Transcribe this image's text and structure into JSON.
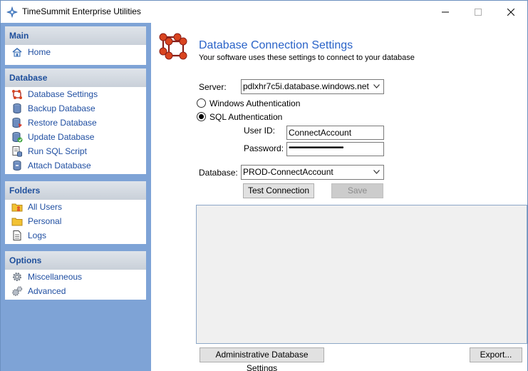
{
  "window": {
    "title": "TimeSummit Enterprise Utilities"
  },
  "sidebar": {
    "main": {
      "header": "Main",
      "items": [
        {
          "label": "Home",
          "icon": "home-icon"
        }
      ]
    },
    "database": {
      "header": "Database",
      "items": [
        {
          "label": "Database Settings",
          "icon": "database-settings-icon"
        },
        {
          "label": "Backup Database",
          "icon": "backup-database-icon"
        },
        {
          "label": "Restore Database",
          "icon": "restore-database-icon"
        },
        {
          "label": "Update Database",
          "icon": "update-database-icon"
        },
        {
          "label": "Run SQL Script",
          "icon": "sql-script-icon"
        },
        {
          "label": "Attach Database",
          "icon": "attach-database-icon"
        }
      ]
    },
    "folders": {
      "header": "Folders",
      "items": [
        {
          "label": "All Users",
          "icon": "all-users-folder-icon"
        },
        {
          "label": "Personal",
          "icon": "personal-folder-icon"
        },
        {
          "label": "Logs",
          "icon": "logs-document-icon"
        }
      ]
    },
    "options": {
      "header": "Options",
      "items": [
        {
          "label": "Miscellaneous",
          "icon": "gear-icon"
        },
        {
          "label": "Advanced",
          "icon": "gears-icon"
        }
      ]
    }
  },
  "content": {
    "title": "Database Connection Settings",
    "subtitle": "Your software uses these settings to connect to your database",
    "server_label": "Server:",
    "server_value": "pdlxhr7c5i.database.windows.net",
    "auth_windows_label": "Windows Authentication",
    "auth_sql_label": "SQL Authentication",
    "auth_selected": "SQL Authentication",
    "userid_label": "User ID:",
    "userid_value": "ConnectAccount",
    "password_label": "Password:",
    "password_mask": "••••••••••••••••••••••••••••••••••••••",
    "database_label": "Database:",
    "database_value": "PROD-ConnectAccount",
    "test_button": "Test Connection",
    "save_button": "Save",
    "admin_button": "Administrative Database Settings",
    "export_button": "Export..."
  },
  "colors": {
    "sidebar_bg": "#7ea3d6",
    "header_text": "#1e4f9c",
    "link_text": "#1f4ea1",
    "title_blue": "#2a63c8"
  }
}
